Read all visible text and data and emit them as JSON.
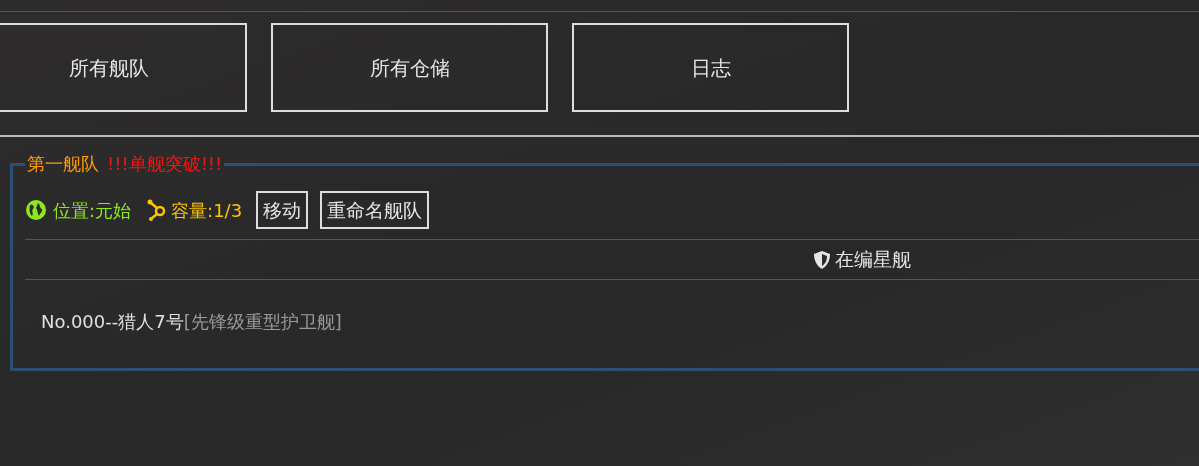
{
  "nav_buttons": [
    {
      "label": "所有舰队"
    },
    {
      "label": "所有仓储"
    },
    {
      "label": "日志"
    }
  ],
  "fleet": {
    "name": "第一舰队",
    "alert": "!!!单舰突破!!!",
    "location": "位置:元始",
    "capacity": "容量:1/3",
    "actions": [
      "移动",
      "重命名舰队"
    ],
    "table_header": "在编星舰",
    "ships": [
      {
        "name": "No.000--猎人7号",
        "class": "[先锋级重型护卫舰]"
      }
    ]
  }
}
